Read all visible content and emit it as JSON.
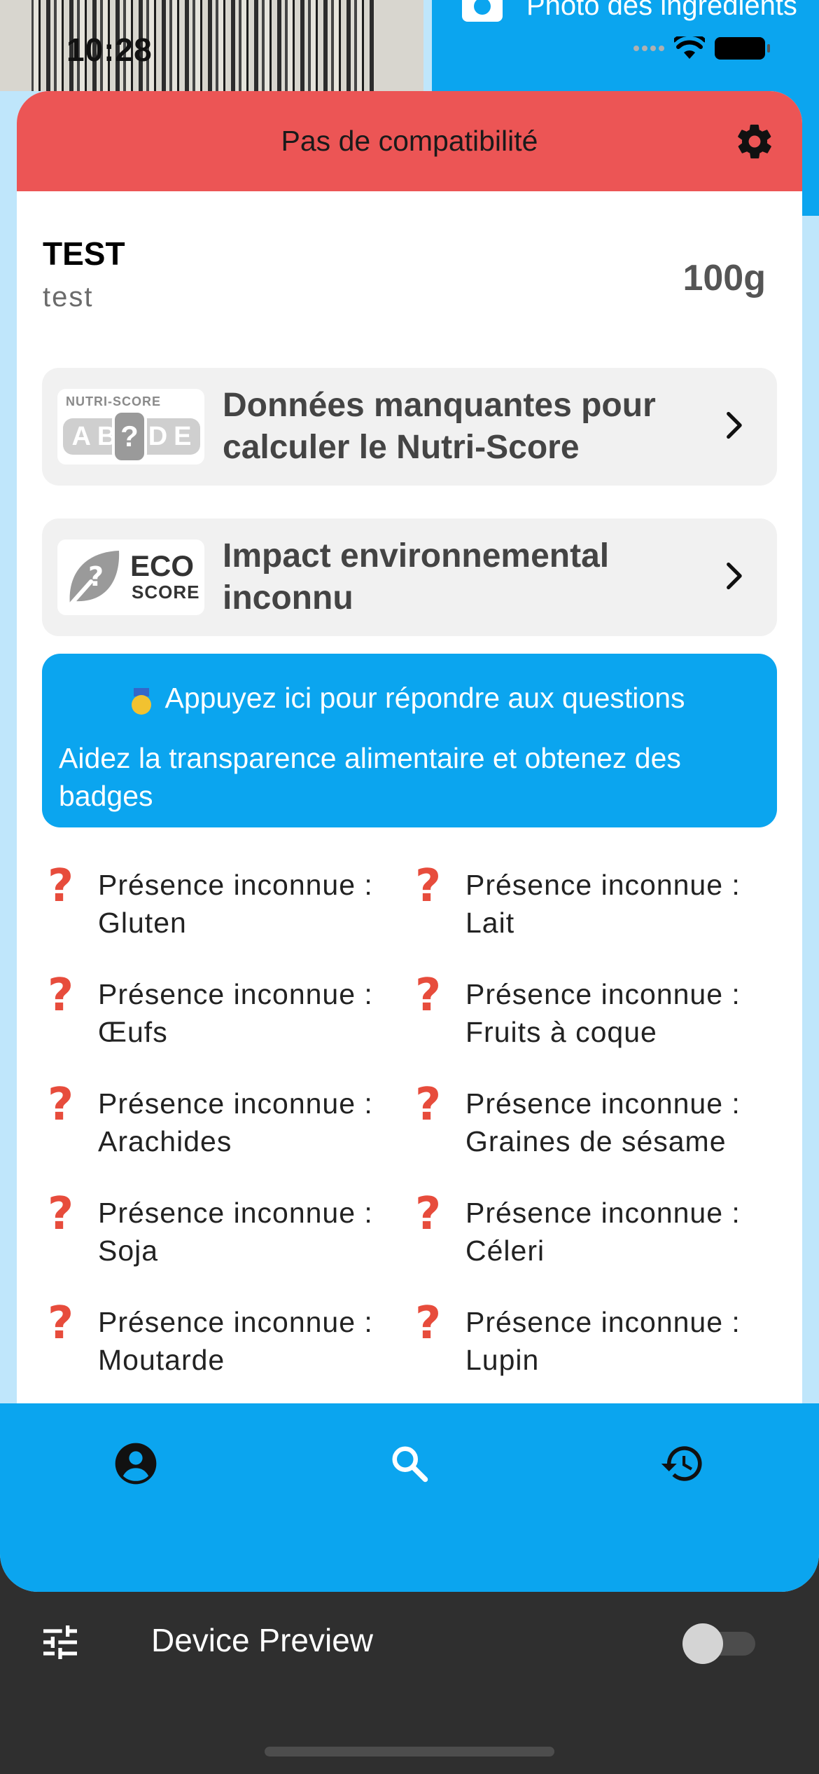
{
  "status_bar": {
    "time": "10:28"
  },
  "background": {
    "photo_label": "Photo des ingrédients"
  },
  "header": {
    "title": "Pas de compatibilité"
  },
  "product": {
    "name": "TEST",
    "brand": "test",
    "quantity": "100g"
  },
  "nutriscore": {
    "logo_title": "NUTRI-SCORE",
    "logo_letters": [
      "A",
      "B",
      "?",
      "D",
      "E"
    ],
    "text": "Données manquantes pour calculer le Nutri-Score"
  },
  "ecoscore": {
    "logo_word": "ECO",
    "logo_sub": "SCORE",
    "text": "Impact environnemental inconnu"
  },
  "questions": {
    "title": "Appuyez ici pour répondre aux questions",
    "subtitle": "Aidez la transparence alimentaire et obtenez des badges"
  },
  "allergens": [
    {
      "label": "Présence inconnue :",
      "name": "Gluten"
    },
    {
      "label": "Présence inconnue :",
      "name": "Lait"
    },
    {
      "label": "Présence inconnue :",
      "name": "Œufs"
    },
    {
      "label": "Présence inconnue :",
      "name": "Fruits à coque"
    },
    {
      "label": "Présence inconnue :",
      "name": "Arachides"
    },
    {
      "label": "Présence inconnue :",
      "name": "Graines de sésame"
    },
    {
      "label": "Présence inconnue :",
      "name": "Soja"
    },
    {
      "label": "Présence inconnue :",
      "name": "Céleri"
    },
    {
      "label": "Présence inconnue :",
      "name": "Moutarde"
    },
    {
      "label": "Présence inconnue :",
      "name": "Lupin"
    }
  ],
  "bottom_nav": {
    "items": [
      "profile-icon",
      "search-icon",
      "history-icon"
    ],
    "active": "search-icon"
  },
  "device_preview": {
    "label": "Device Preview",
    "enabled": false
  },
  "colors": {
    "header_red": "#ec5555",
    "accent_blue": "#0ba5ef",
    "unknown_red": "#e74c3c"
  }
}
